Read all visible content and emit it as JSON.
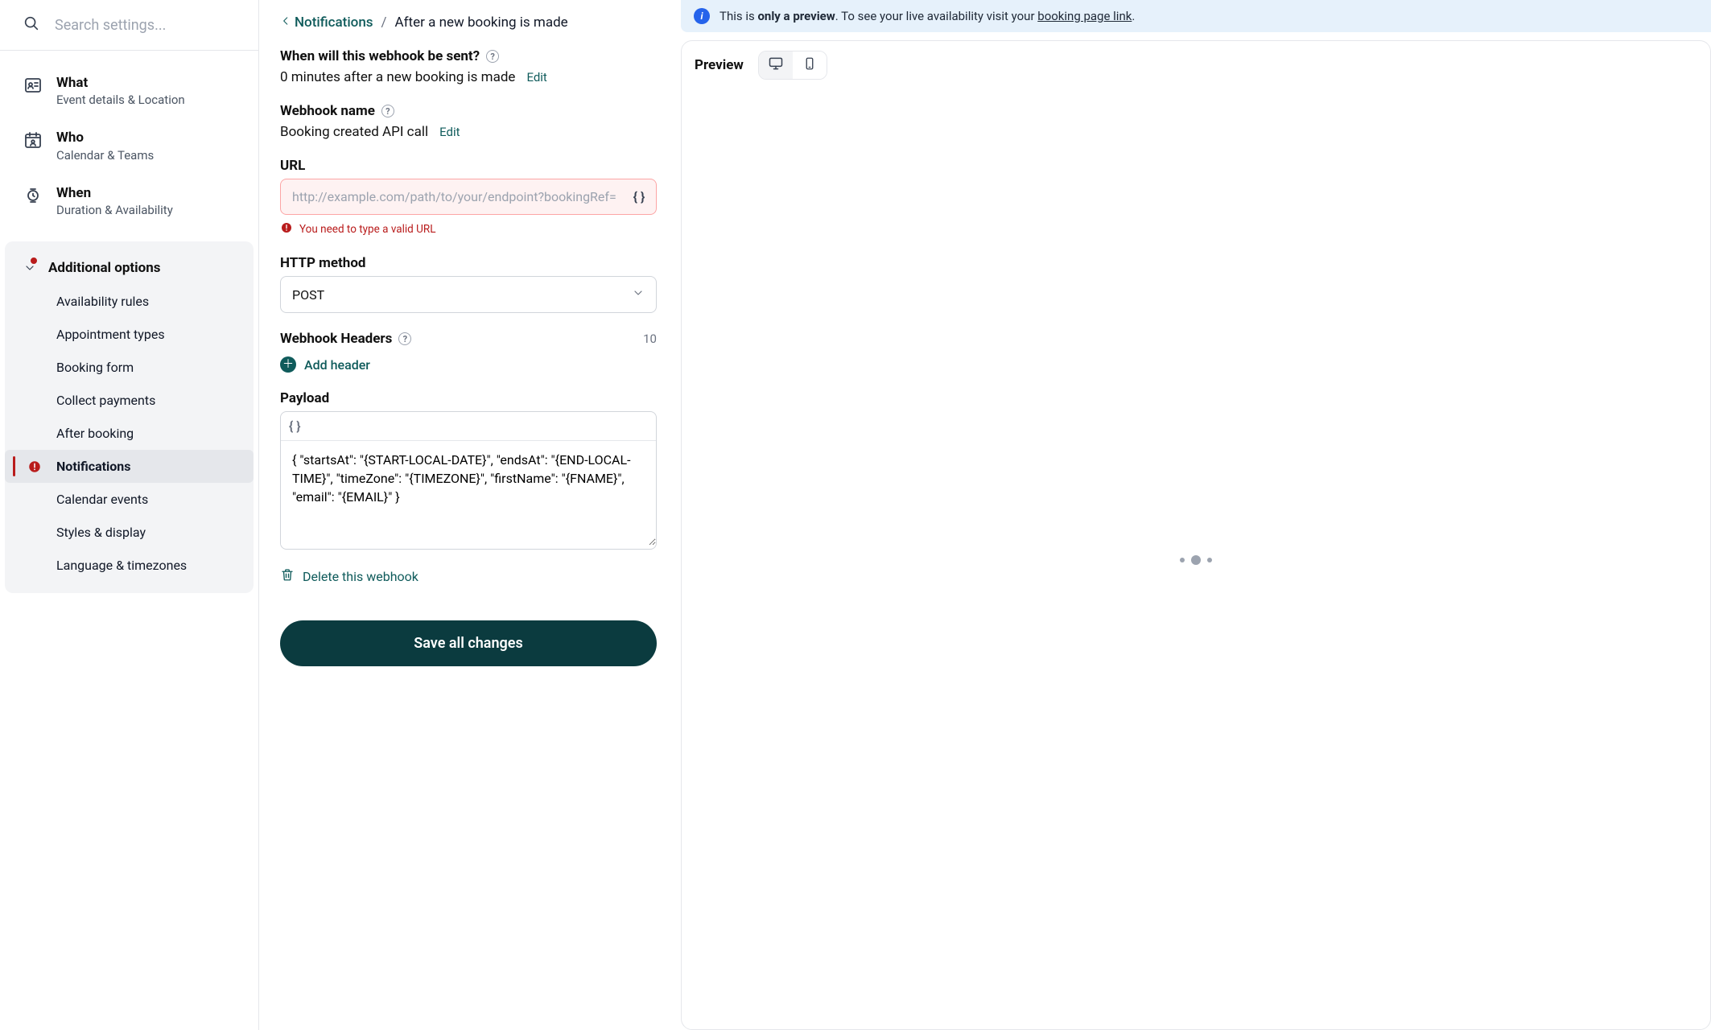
{
  "search": {
    "placeholder": "Search settings..."
  },
  "primaryNav": [
    {
      "title": "What",
      "sub": "Event details & Location"
    },
    {
      "title": "Who",
      "sub": "Calendar & Teams"
    },
    {
      "title": "When",
      "sub": "Duration & Availability"
    }
  ],
  "additional": {
    "header": "Additional options",
    "items": [
      "Availability rules",
      "Appointment types",
      "Booking form",
      "Collect payments",
      "After booking",
      "Notifications",
      "Calendar events",
      "Styles & display",
      "Language & timezones"
    ],
    "activeIndex": 5
  },
  "breadcrumb": {
    "back": "Notifications",
    "current": "After a new booking is made"
  },
  "fields": {
    "when": {
      "label": "When will this webhook be sent?",
      "value": "0 minutes after a new booking is made",
      "edit": "Edit"
    },
    "name": {
      "label": "Webhook name",
      "value": "Booking created API call",
      "edit": "Edit"
    },
    "url": {
      "label": "URL",
      "placeholder": "http://example.com/path/to/your/endpoint?bookingRef=",
      "error": "You need to type a valid URL"
    },
    "method": {
      "label": "HTTP method",
      "value": "POST"
    },
    "headers": {
      "label": "Webhook Headers",
      "count": "10",
      "add": "Add header"
    },
    "payload": {
      "label": "Payload",
      "value": "{ \"startsAt\": \"{START-LOCAL-DATE}\", \"endsAt\": \"{END-LOCAL-TIME}\", \"timeZone\": \"{TIMEZONE}\", \"firstName\": \"{FNAME}\", \"email\": \"{EMAIL}\" }"
    },
    "delete": "Delete this webhook",
    "save": "Save all changes"
  },
  "preview": {
    "banner_pre": "This is ",
    "banner_strong": "only a preview",
    "banner_mid": ". To see your live availability visit your ",
    "banner_link": "booking page link",
    "banner_post": ".",
    "title": "Preview"
  }
}
